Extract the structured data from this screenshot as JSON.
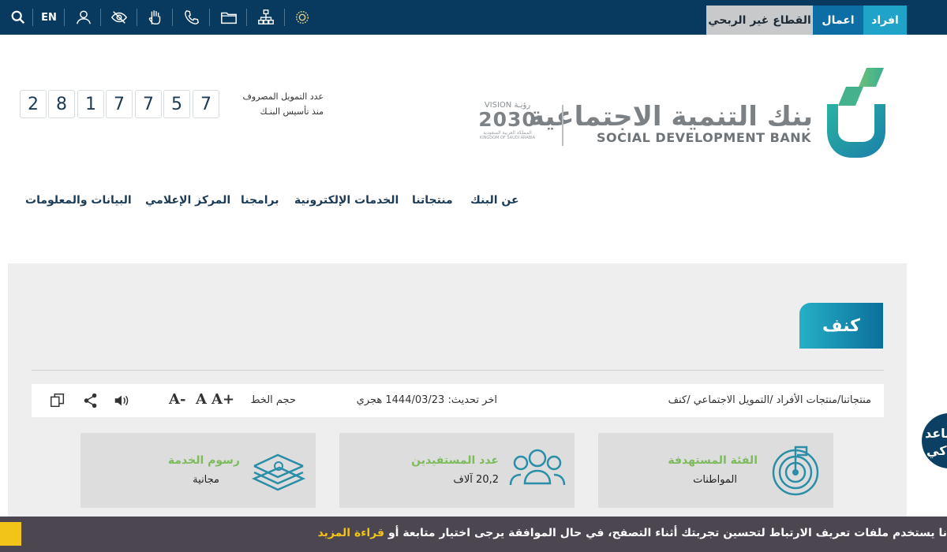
{
  "topbar": {
    "lang": "EN",
    "segments": {
      "individuals": "افراد",
      "business": "اعمال",
      "nonprofit": "القطاع غير الربحي"
    },
    "colors": {
      "bar": "#073a5e",
      "individuals": "#1fa3c9",
      "business": "#0d6ea6",
      "nonprofit": "#c7c9cb"
    }
  },
  "header": {
    "logo_ar": "بنك التنمية الاجتماعية",
    "logo_en": "SOCIAL DEVELOPMENT BANK",
    "vision": {
      "top": "VISION رؤيـة",
      "year": "2030",
      "sub1": "المملكة العربية السعودية",
      "sub2": "KINGDOM OF SAUDI ARABIA"
    },
    "counter_digits": [
      "2",
      "8",
      "1",
      "7",
      "7",
      "5",
      "7"
    ],
    "counter_label_1": "عدد التمويل المصروف",
    "counter_label_2": "منذ تأسيس البنـك"
  },
  "nav": {
    "about": "عن البنك",
    "products": "منتجاتنا",
    "eservices": "الخدمات الإلكترونية",
    "programs": "برامجنا",
    "media": "المركز الإعلامي",
    "data": "البيانات والمعلومات"
  },
  "page": {
    "title": "كنف",
    "breadcrumb": "منتجاتنا/منتجات الأفراد /التمويل الاجتماعي /كنف",
    "last_update": "اخر تحديث: 1444/03/23 هجري",
    "font_size_label": "حجم الخط",
    "font_plus": "A+",
    "font_normal": "A",
    "font_minus": "A-"
  },
  "cards": [
    {
      "title": "الفئة المستهدفة",
      "value": "المواطنات",
      "icon": "target-icon"
    },
    {
      "title": "عدد المستفيدين",
      "value": "20,2 آلاف",
      "icon": "people-icon"
    },
    {
      "title": "رسوم الخدمة",
      "value": "مجانية",
      "icon": "money-stack-icon"
    }
  ],
  "assistant": {
    "label_1": "ساعد",
    "label_2": "ذكي"
  },
  "cookie": {
    "text": "نا يستخدم ملفات تعريف الارتباط لتحسين تجربتك أثناء التصفح، في حال الموافقة يرجى اختيار متابعة أو",
    "link": "قراءة المزيد"
  }
}
